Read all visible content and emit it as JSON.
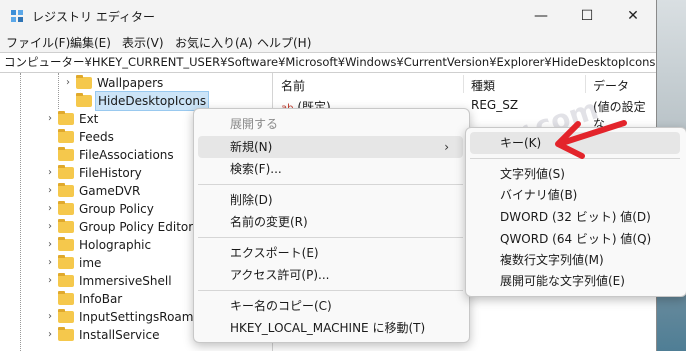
{
  "window": {
    "title": "レジストリ エディター",
    "minimize_glyph": "—",
    "maximize_glyph": "☐",
    "close_glyph": "✕"
  },
  "menubar": [
    "ファイル(F)",
    "編集(E)",
    "表示(V)",
    "お気に入り(A)",
    "ヘルプ(H)"
  ],
  "address": "コンピューター¥HKEY_CURRENT_USER¥Software¥Microsoft¥Windows¥CurrentVersion¥Explorer¥HideDesktopIcons",
  "tree": {
    "items": [
      {
        "label": "Wallpapers",
        "expandable": true,
        "selected": false
      },
      {
        "label": "HideDesktopIcons",
        "expandable": false,
        "selected": true
      },
      {
        "label": "Ext",
        "expandable": true,
        "selected": false
      },
      {
        "label": "Feeds",
        "expandable": false,
        "selected": false
      },
      {
        "label": "FileAssociations",
        "expandable": false,
        "selected": false
      },
      {
        "label": "FileHistory",
        "expandable": true,
        "selected": false
      },
      {
        "label": "GameDVR",
        "expandable": true,
        "selected": false
      },
      {
        "label": "Group Policy",
        "expandable": true,
        "selected": false
      },
      {
        "label": "Group Policy Editor",
        "expandable": true,
        "selected": false
      },
      {
        "label": "Holographic",
        "expandable": true,
        "selected": false
      },
      {
        "label": "ime",
        "expandable": true,
        "selected": false
      },
      {
        "label": "ImmersiveShell",
        "expandable": true,
        "selected": false
      },
      {
        "label": "InfoBar",
        "expandable": false,
        "selected": false
      },
      {
        "label": "InputSettingsRoamin",
        "expandable": true,
        "selected": false
      },
      {
        "label": "InstallService",
        "expandable": true,
        "selected": false
      }
    ]
  },
  "list": {
    "columns": [
      "名前",
      "種類",
      "データ"
    ],
    "rows": [
      {
        "name": "(既定)",
        "type": "REG_SZ",
        "data": "(値の設定な"
      }
    ]
  },
  "context_menu": {
    "items": [
      {
        "label": "展開する",
        "disabled": true
      },
      {
        "label": "新規(N)",
        "submenu": true,
        "highlighted": true
      },
      {
        "label": "検索(F)..."
      },
      {
        "label": "削除(D)"
      },
      {
        "label": "名前の変更(R)"
      },
      {
        "label": "エクスポート(E)"
      },
      {
        "label": "アクセス許可(P)..."
      },
      {
        "label": "キー名のコピー(C)"
      },
      {
        "label": "HKEY_LOCAL_MACHINE に移動(T)"
      }
    ],
    "submenu_arrow": "›"
  },
  "submenu": {
    "items": [
      {
        "label": "キー(K)",
        "highlighted": true
      },
      {
        "label": "文字列値(S)"
      },
      {
        "label": "バイナリ値(B)"
      },
      {
        "label": "DWORD (32 ビット) 値(D)"
      },
      {
        "label": "QWORD (64 ビット) 値(Q)"
      },
      {
        "label": "複数行文字列値(M)"
      },
      {
        "label": "展開可能な文字列値(E)"
      }
    ]
  },
  "watermark": "www.nichepcgamer.com",
  "colors": {
    "folder": "#f5c84c",
    "selection": "#cce4f7",
    "annotation_arrow": "#e3242b"
  }
}
